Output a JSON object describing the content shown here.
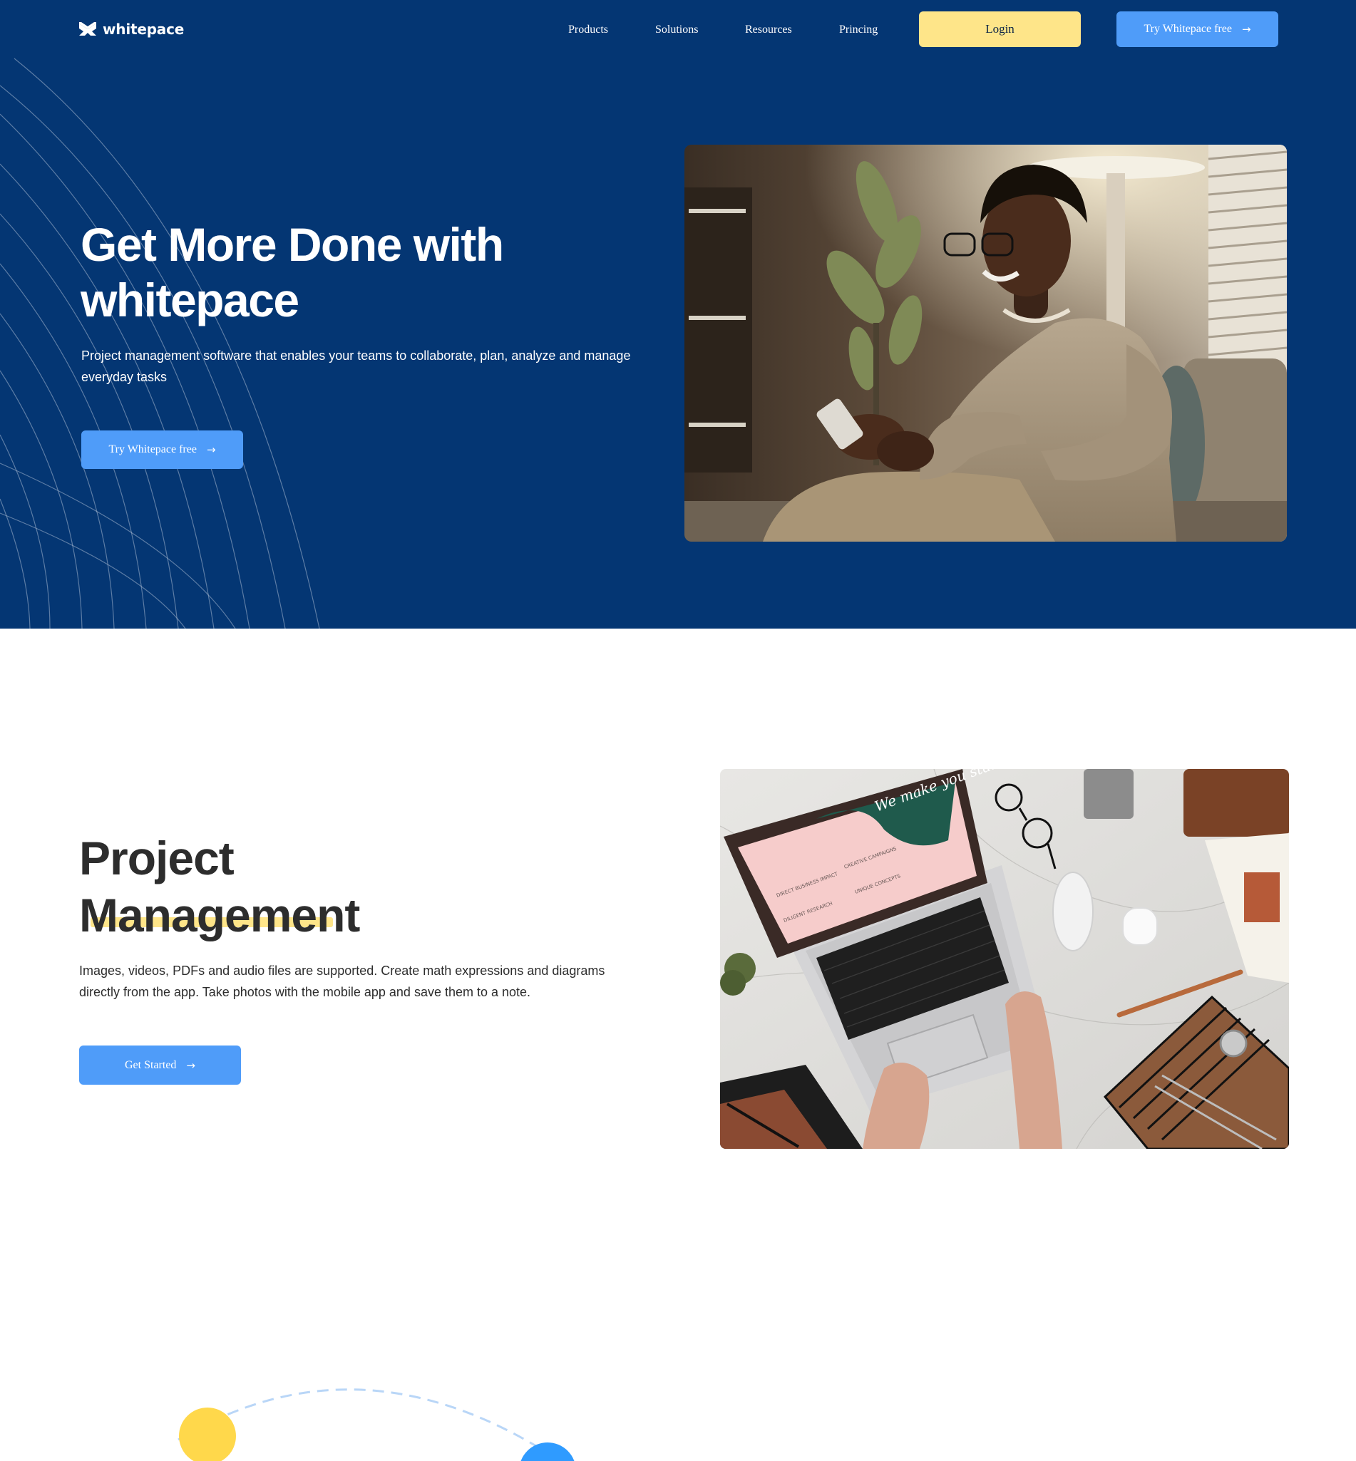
{
  "brand": {
    "name": "whitepace"
  },
  "nav": {
    "links": [
      "Products",
      "Solutions",
      "Resources",
      "Princing"
    ],
    "login_label": "Login",
    "try_label": "Try Whitepace free"
  },
  "hero": {
    "title": "Get More Done with whitepace",
    "subtitle": "Project management software that enables your teams to collaborate, plan, analyze and manage everyday tasks",
    "cta_label": "Try Whitepace free"
  },
  "project_management": {
    "title_line1": "Project",
    "title_line2": "Management",
    "body": "Images, videos, PDFs and audio files are supported. Create math expressions and diagrams directly from the app. Take photos with the mobile app and save them to a note.",
    "cta_label": "Get Started"
  },
  "laptop_screen": {
    "headline": "We make you stand out!",
    "items": [
      "DIRECT BUSINESS IMPACT",
      "CREATIVE CAMPAIGNS",
      "DILIGENT RESEARCH",
      "UNIQUE CONCEPTS"
    ]
  },
  "icons": {
    "arrow": "arrow-right-icon",
    "logo": "whitepace-logo-icon"
  },
  "colors": {
    "hero_bg": "#043673",
    "accent_blue": "#4f9cf9",
    "accent_yellow": "#fee589",
    "text_dark": "#2d2d2d"
  }
}
